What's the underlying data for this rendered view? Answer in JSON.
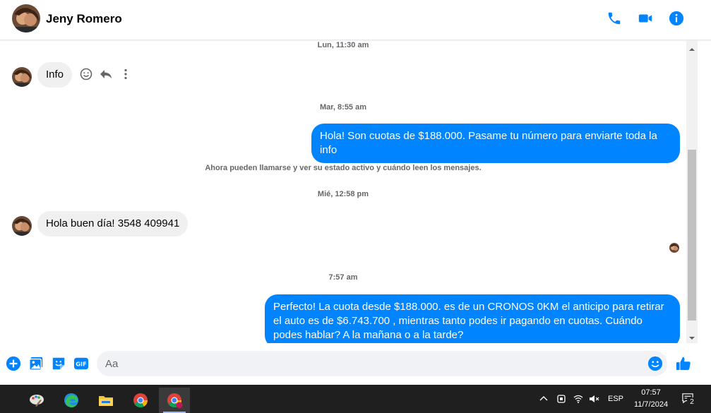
{
  "colors": {
    "accent": "#0084ff",
    "incoming_bubble": "#f0f0f0",
    "taskbar": "#1f1f1f"
  },
  "header": {
    "contact_name": "Jeny Romero",
    "icons": [
      "phone-icon",
      "video-camera-icon",
      "info-icon"
    ]
  },
  "conversation": {
    "items": [
      {
        "kind": "timestamp",
        "text": "Lun, 11:30 am"
      },
      {
        "kind": "incoming",
        "text": "Info"
      },
      {
        "kind": "timestamp",
        "text": "Mar, 8:55 am"
      },
      {
        "kind": "outgoing",
        "text": "Hola! Son cuotas de $188.000. Pasame tu número para enviarte toda la info"
      },
      {
        "kind": "notice",
        "text": "Ahora pueden llamarse y ver su estado activo y cuándo leen los mensajes."
      },
      {
        "kind": "timestamp",
        "text": "Mié, 12:58 pm"
      },
      {
        "kind": "incoming",
        "text": "Hola buen día! 3548 409941"
      },
      {
        "kind": "timestamp",
        "text": "7:57 am"
      },
      {
        "kind": "outgoing",
        "text": "Perfecto! La cuota desde $188.000. es de un CRONOS 0KM el anticipo para retirar el auto es de $6.743.700 , mientras tanto podes ir pagando en cuotas. Cuándo podes hablar? A la mañana o a la tarde?"
      }
    ]
  },
  "composer": {
    "placeholder": "Aa",
    "icons": [
      "plus-circle-icon",
      "photo-icon",
      "sticker-icon",
      "gif-icon",
      "emoji-icon",
      "thumbs-up-icon"
    ]
  },
  "taskbar": {
    "apps": [
      "paint-icon",
      "edge-icon",
      "file-explorer-icon",
      "chrome-icon",
      "chrome-profile-icon"
    ],
    "language": "ESP",
    "time": "07:57",
    "date": "11/7/2024",
    "notification_count": "2"
  }
}
